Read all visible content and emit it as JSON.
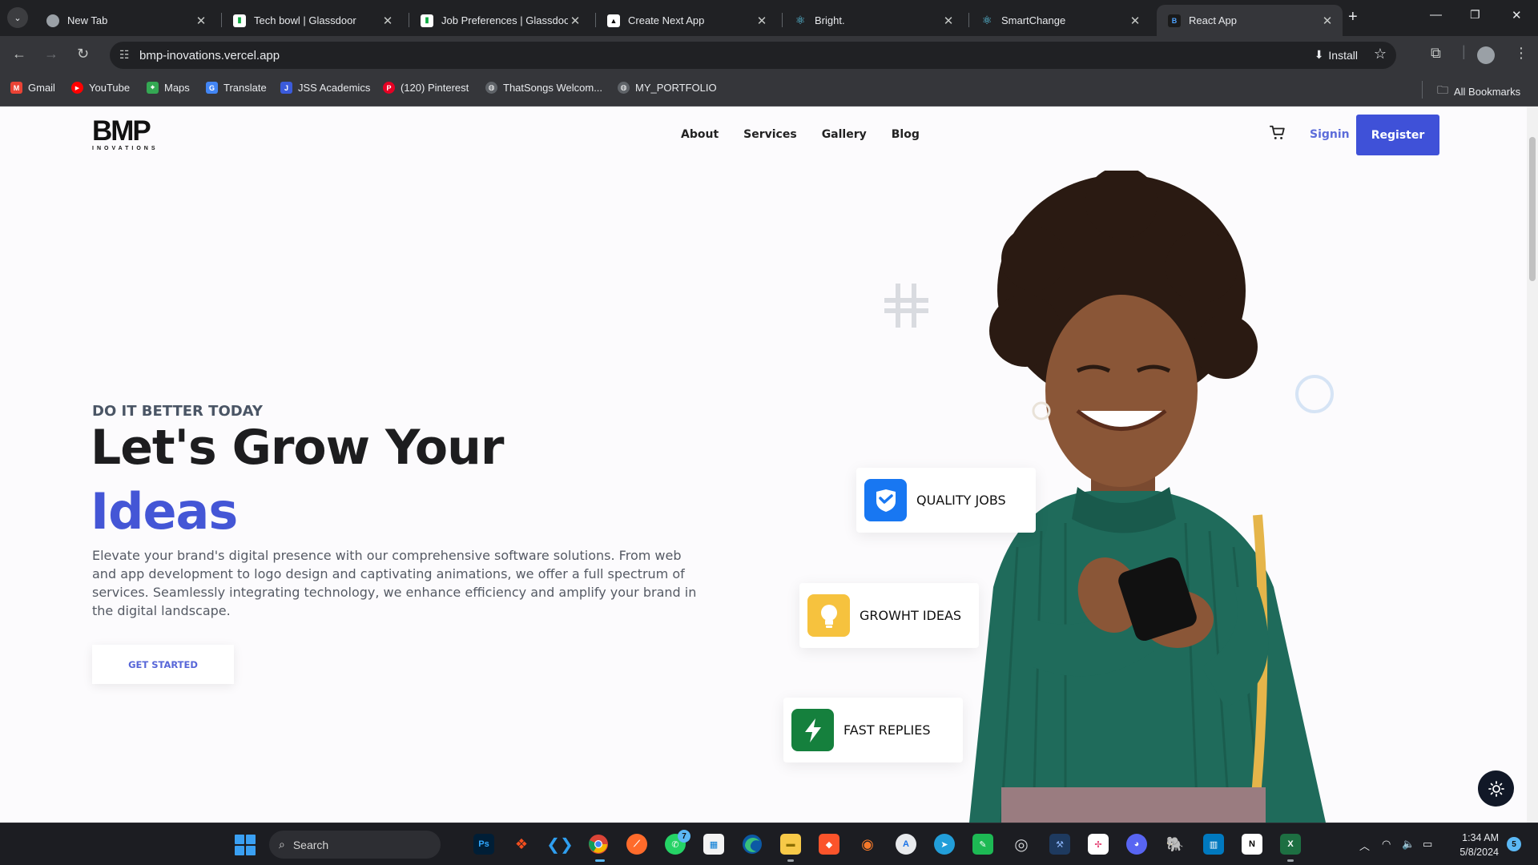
{
  "browser": {
    "tabs": [
      {
        "title": "New Tab",
        "favicon": "chrome-icon",
        "active": false
      },
      {
        "title": "Tech bowl | Glassdoor",
        "favicon": "glassdoor-icon",
        "active": false
      },
      {
        "title": "Job Preferences | Glassdoor",
        "favicon": "glassdoor-icon",
        "active": false
      },
      {
        "title": "Create Next App",
        "favicon": "vercel-icon",
        "active": false
      },
      {
        "title": "Bright.",
        "favicon": "react-icon",
        "active": false
      },
      {
        "title": "SmartChange",
        "favicon": "react-icon",
        "active": false
      },
      {
        "title": "React App",
        "favicon": "bmp-icon",
        "active": true
      }
    ],
    "url": "bmp-inovations.vercel.app",
    "install_label": "Install",
    "bookmarks": [
      {
        "label": "Gmail",
        "icon": "gmail-icon",
        "color": "#ea4335"
      },
      {
        "label": "YouTube",
        "icon": "youtube-icon",
        "color": "#ff0000"
      },
      {
        "label": "Maps",
        "icon": "maps-icon",
        "color": "#34a853"
      },
      {
        "label": "Translate",
        "icon": "translate-icon",
        "color": "#4285f4"
      },
      {
        "label": "JSS Academics",
        "icon": "jss-icon",
        "color": "#3b5bdb"
      },
      {
        "label": "(120) Pinterest",
        "icon": "pinterest-icon",
        "color": "#e60023"
      },
      {
        "label": "ThatSongs Welcom...",
        "icon": "globe-icon",
        "color": "#9aa0a6"
      },
      {
        "label": "MY_PORTFOLIO",
        "icon": "globe-icon",
        "color": "#9aa0a6"
      }
    ],
    "all_bookmarks_label": "All Bookmarks"
  },
  "site": {
    "logo_text": "BMP",
    "logo_subtext": "INOVATIONS",
    "nav": [
      "About",
      "Services",
      "Gallery",
      "Blog"
    ],
    "signin_label": "Signin",
    "register_label": "Register",
    "hero": {
      "eyebrow": "DO IT BETTER TODAY",
      "headline_line1": "Let's Grow Your",
      "headline_line2": "Ideas",
      "lead": "Elevate your brand's digital presence with our comprehensive software solutions. From web and app development to logo design and captivating animations, we offer a full spectrum of services. Seamlessly integrating technology, we enhance efficiency and amplify your brand in the digital landscape.",
      "cta_label": "GET STARTED"
    },
    "features": [
      {
        "label": "QUALITY JOBS",
        "icon": "handshake-icon",
        "color": "#1877f2"
      },
      {
        "label": "GROWHT IDEAS",
        "icon": "lightbulb-icon",
        "color": "#f6c23e"
      },
      {
        "label": "FAST REPLIES",
        "icon": "lightning-icon",
        "color": "#15803d"
      }
    ],
    "accent_color": "#3f51d8"
  },
  "taskbar": {
    "search_label": "Search",
    "time": "1:34 AM",
    "date": "5/8/2024",
    "notification_count": "5",
    "whatsapp_badge": "7"
  }
}
